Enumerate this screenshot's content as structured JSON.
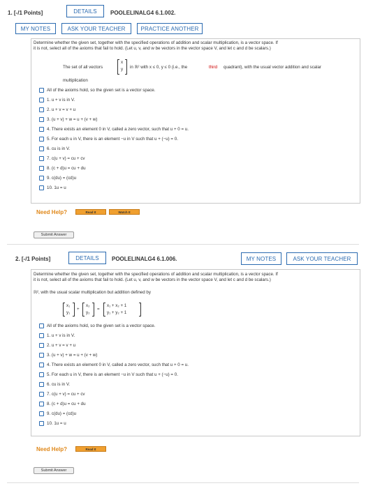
{
  "q1": {
    "number": "1. [-/1 Points]",
    "details": "DETAILS",
    "code": "POOLELINALG4 6.1.002.",
    "my_notes": "MY NOTES",
    "ask_teacher": "ASK YOUR TEACHER",
    "practice": "PRACTICE ANOTHER",
    "intro1": "Determine whether the given set, together with the specified operations of addition and scalar multiplication, is a vector space. If",
    "intro2": "it is not, select all of the axioms that fail to hold. (Let u, v, and w be vectors in the vector space V, and let c and d be scalars.)",
    "set_a": "The set of all vectors",
    "set_b": "in ℝ² with x ≤ 0, y ≤ 0 (i.e., the",
    "set_third": "third",
    "set_c": "quadrant), with the usual vector addition and scalar",
    "set_d": "multiplication",
    "vec_x": "x",
    "vec_y": "y",
    "options": [
      "All of the axioms hold, so the given set is a vector space.",
      "1. u + v is in V.",
      "2. u + v = v + u",
      "3. (u + v) + w = u + (v + w)",
      "4. There exists an element 0 in V, called a zero vector, such that u + 0 = u.",
      "5. For each u in V, there is an element −u in V such that u + (−u) = 0.",
      "6. cu is in V.",
      "7. c(u + v) = cu + cv",
      "8. (c + d)u = cu + du",
      "9. c(du) = (cd)u",
      "10. 1u = u"
    ],
    "need_help": "Need Help?",
    "read_it": "Read It",
    "watch_it": "Watch It",
    "submit": "Submit Answer"
  },
  "q2": {
    "number": "2. [-/1 Points]",
    "details": "DETAILS",
    "code": "POOLELINALG4 6.1.006.",
    "my_notes": "MY NOTES",
    "ask_teacher": "ASK YOUR TEACHER",
    "intro1": "Determine whether the given set, together with the specified operations of addition and scalar multiplication, is a vector space. If",
    "intro2": "it is not, select all of the axioms that fail to hold. (Let u, v, and w be vectors in the vector space V, and let c and d be scalars.)",
    "def_line": "ℝ², with the usual scalar multiplication but addition defined by",
    "m_x1": "x₁",
    "m_y1": "y₁",
    "m_x2": "x₂",
    "m_y2": "y₂",
    "m_plus": "+",
    "m_eq": "=",
    "m_r1": "x₁ + x₂ + 1",
    "m_r2": "y₁ + y₂ + 1",
    "options": [
      "All of the axioms hold, so the given set is a vector space.",
      "1. u + v is in V.",
      "2. u + v = v + u",
      "3. (u + v) + w = u + (v + w)",
      "4. There exists an element 0 in V, called a zero vector, such that u + 0 = u.",
      "5. For each u in V, there is an element −u in V such that u + (−u) = 0.",
      "6. cu is in V.",
      "7. c(u + v) = cu + cv",
      "8. (c + d)u = cu + du",
      "9. c(du) = (cd)u",
      "10. 1u = u"
    ],
    "need_help": "Need Help?",
    "read_it": "Read It",
    "submit": "Submit Answer"
  }
}
